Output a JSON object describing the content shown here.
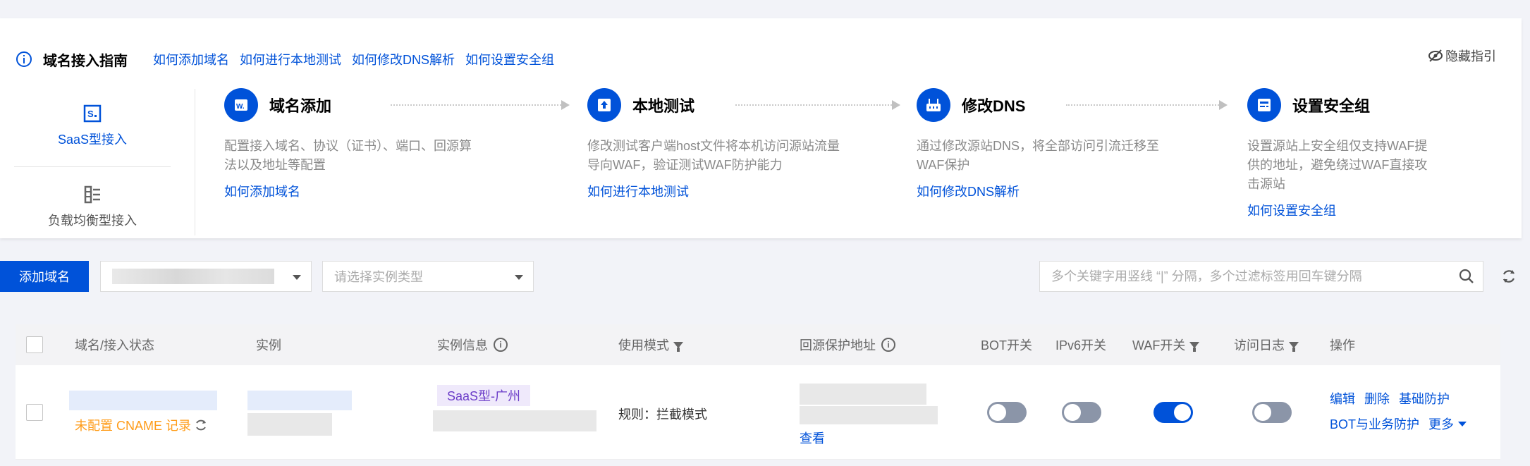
{
  "guide": {
    "title": "域名接入指南",
    "links": [
      "如何添加域名",
      "如何进行本地测试",
      "如何修改DNS解析",
      "如何设置安全组"
    ],
    "hide_label": "隐藏指引",
    "tabs": [
      {
        "label": "SaaS型接入",
        "icon": "saas-icon"
      },
      {
        "label": "负载均衡型接入",
        "icon": "load-balancer-icon"
      }
    ],
    "steps": [
      {
        "title": "域名添加",
        "desc": "配置接入域名、协议（证书）、端口、回源算法以及地址等配置",
        "link": "如何添加域名"
      },
      {
        "title": "本地测试",
        "desc": "修改测试客户端host文件将本机访问源站流量导向WAF，验证测试WAF防护能力",
        "link": "如何进行本地测试"
      },
      {
        "title": "修改DNS",
        "desc": "通过修改源站DNS，将全部访问引流迁移至WAF保护",
        "link": "如何修改DNS解析"
      },
      {
        "title": "设置安全组",
        "desc": "设置源站上安全组仅支持WAF提供的地址，避免绕过WAF直接攻击源站",
        "link": "如何设置安全组"
      }
    ]
  },
  "toolbar": {
    "add_label": "添加域名",
    "instance_type_placeholder": "请选择实例类型",
    "search_placeholder": "多个关键字用竖线 “|” 分隔，多个过滤标签用回车键分隔"
  },
  "table": {
    "headers": {
      "domain": "域名/接入状态",
      "instance": "实例",
      "instance_info": "实例信息",
      "mode": "使用模式",
      "origin": "回源保护地址",
      "bot": "BOT开关",
      "ipv6": "IPv6开关",
      "waf": "WAF开关",
      "log": "访问日志",
      "ops": "操作"
    },
    "row": {
      "status": "未配置 CNAME 记录",
      "tag": "SaaS型-广州",
      "mode": "规则：拦截模式",
      "origin_view": "查看",
      "bot_on": false,
      "ipv6_on": false,
      "waf_on": true,
      "log_on": false,
      "ops": {
        "edit": "编辑",
        "delete": "删除",
        "basic": "基础防护",
        "bot_biz": "BOT与业务防护",
        "more": "更多"
      }
    }
  },
  "colors": {
    "accent": "#0052d9",
    "warn": "#ff9c19",
    "tag_text": "#6b3cc8"
  }
}
